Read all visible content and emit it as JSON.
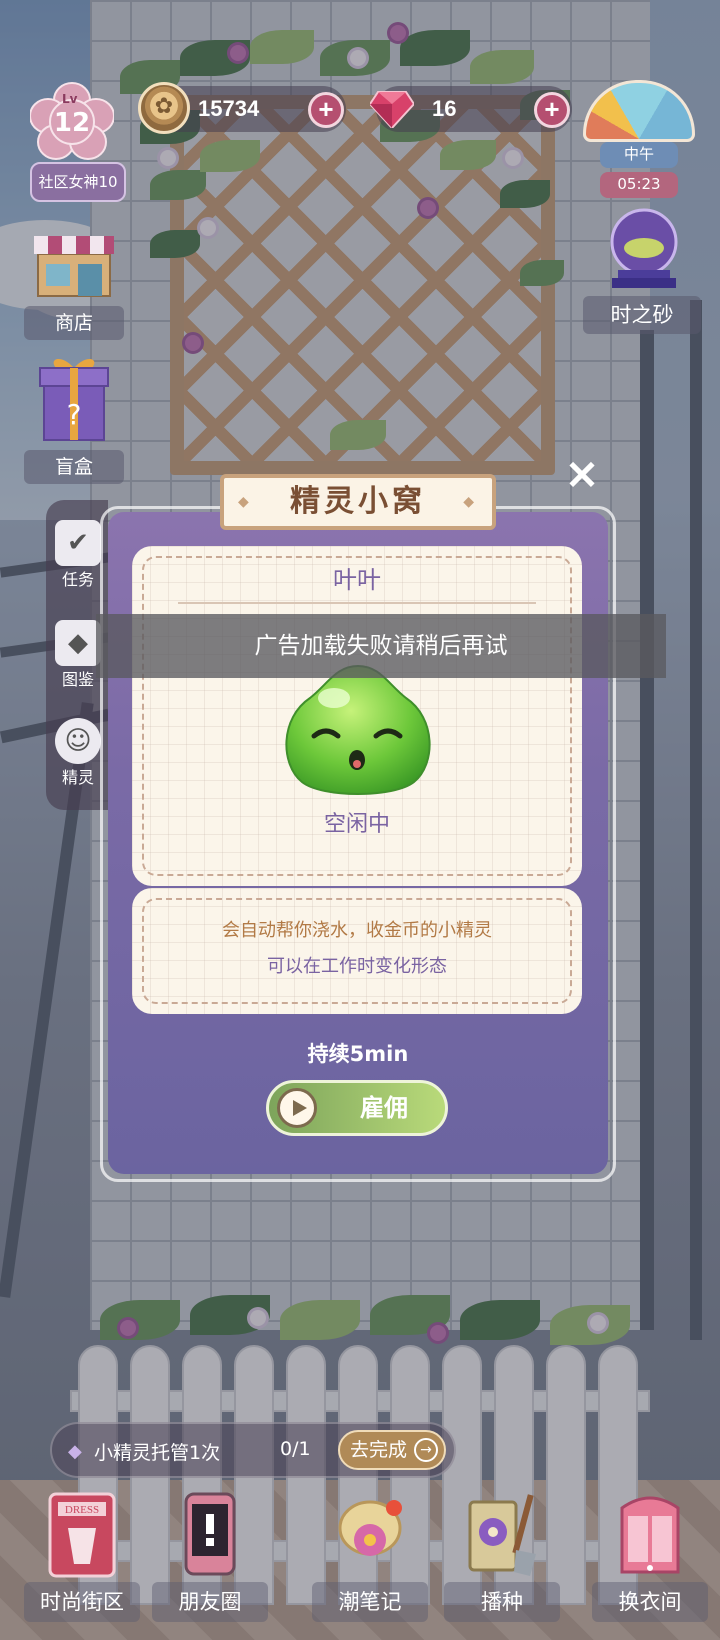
{
  "currency": {
    "coins": "15734",
    "gems": "16",
    "plus": "+"
  },
  "player": {
    "level_prefix": "Lv",
    "level": "12",
    "title": "社区女神10"
  },
  "left_menu": {
    "shop": "商店",
    "blind_box": "盲盒"
  },
  "left_tabs": {
    "tasks": "任务",
    "catalog": "图鉴",
    "spirit": "精灵"
  },
  "time": {
    "period": "中午",
    "clock": "05:23",
    "sand_label": "时之砂"
  },
  "dialog": {
    "title": "精灵小窝",
    "close": "✕",
    "spirit_name": "叶叶",
    "status": "空闲中",
    "desc_line1": "会自动帮你浇水，收金币的小精灵",
    "desc_line2": "可以在工作时变化形态",
    "duration": "持续5min",
    "hire_label": "雇佣"
  },
  "toast": "广告加载失败请稍后再试",
  "task": {
    "text": "小精灵托管1次",
    "count": "0/1",
    "go_label": "去完成",
    "go_arrow": "→"
  },
  "bottom_nav": {
    "fashion_street": "时尚街区",
    "moments": "朋友圈",
    "trend_notes": "潮笔记",
    "sow": "播种",
    "dressing_room": "换衣间",
    "dress_icon_text": "DRESS"
  },
  "colors": {
    "dialog_purple": "#7a6aa6",
    "accent_gold": "#b08a57",
    "hire_green": "#8fbf63",
    "plus_pink": "#b54f70"
  }
}
